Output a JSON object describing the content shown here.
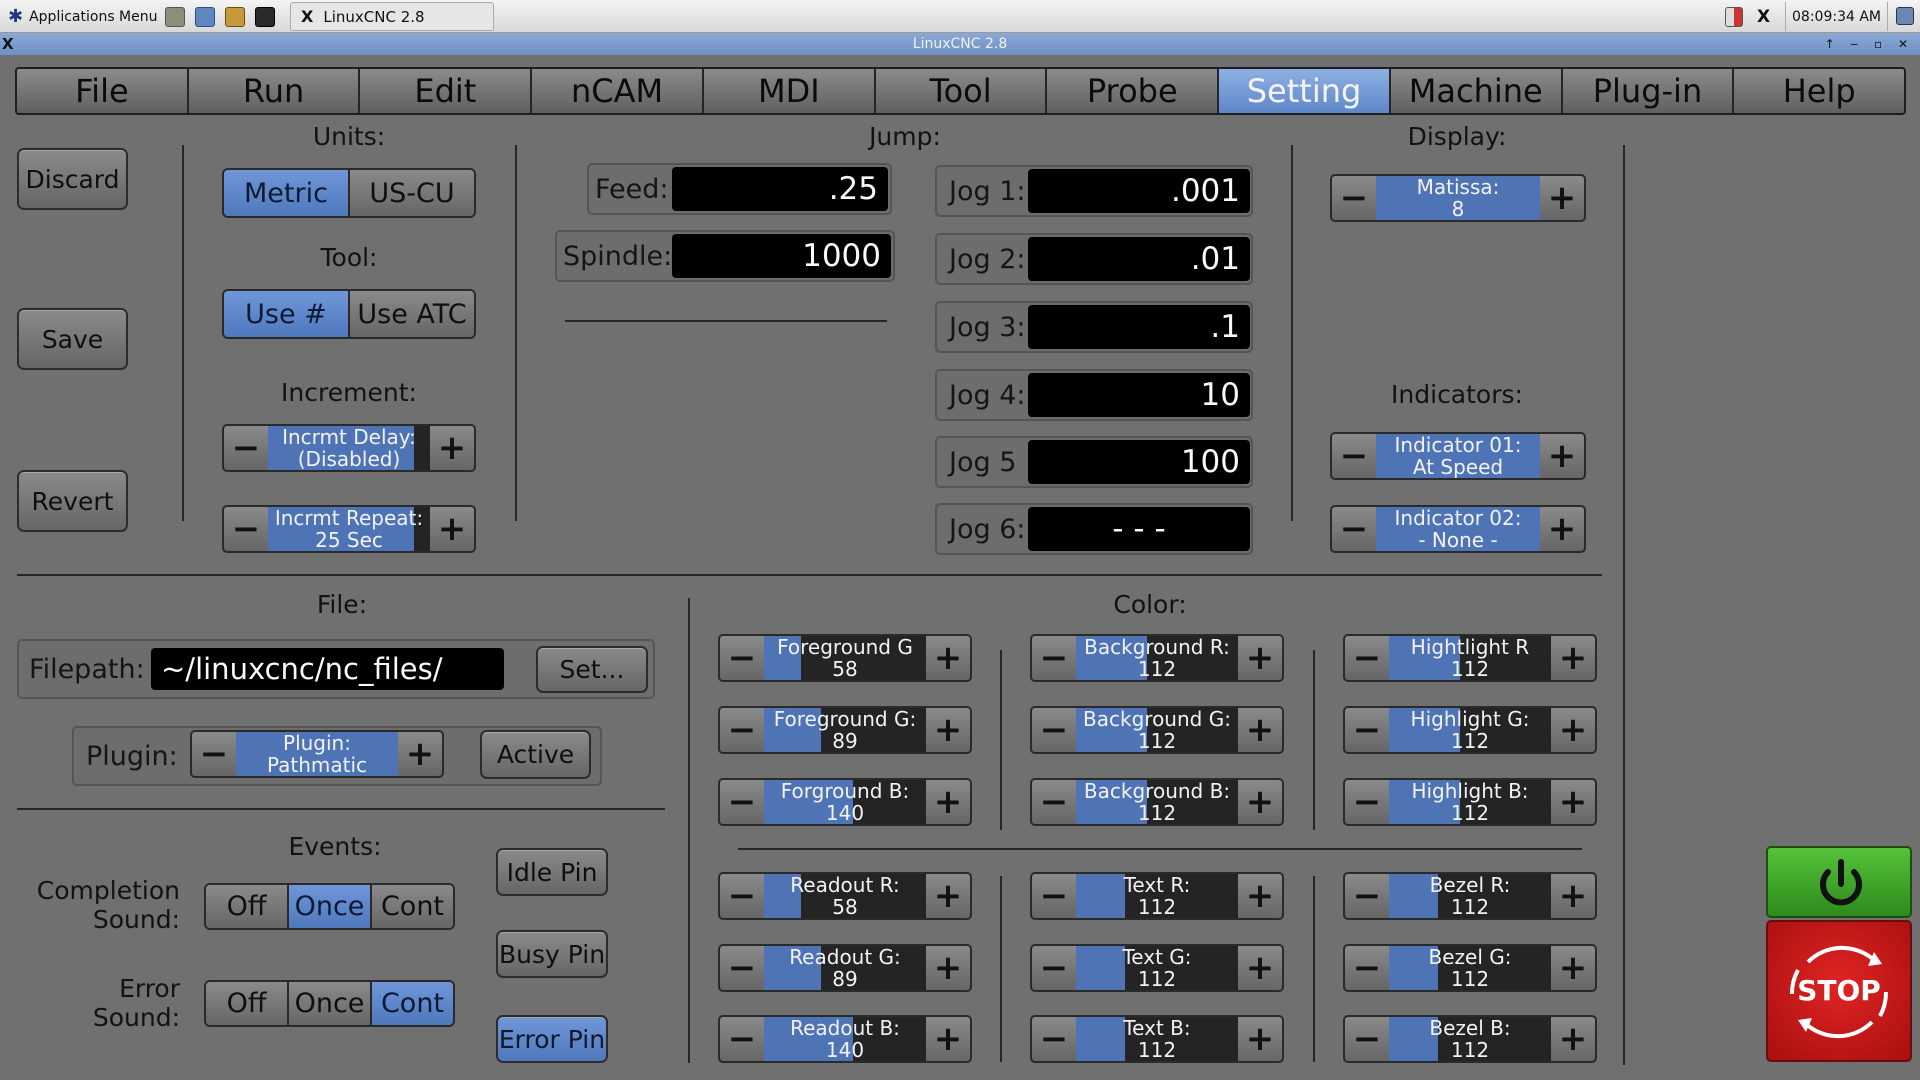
{
  "taskbar": {
    "apps_menu": "Applications Menu",
    "task_title": "LinuxCNC 2.8",
    "clock": "08:09:34 AM",
    "x_label": "X"
  },
  "window": {
    "title": "LinuxCNC 2.8"
  },
  "menu": {
    "tabs": [
      "File",
      "Run",
      "Edit",
      "nCAM",
      "MDI",
      "Tool",
      "Probe",
      "Setting",
      "Machine",
      "Plug-in",
      "Help"
    ],
    "active": "Setting"
  },
  "actions": {
    "discard": "Discard",
    "save": "Save",
    "revert": "Revert"
  },
  "units": {
    "heading": "Units:",
    "options": [
      "Metric",
      "US-CU"
    ],
    "selected": "Metric"
  },
  "tool": {
    "heading": "Tool:",
    "options": [
      "Use #",
      "Use ATC"
    ],
    "selected": "Use #"
  },
  "increment": {
    "heading": "Increment:",
    "delay": {
      "line1": "Incrmt Delay:",
      "line2": "(Disabled)",
      "fill": 0.9
    },
    "repeat": {
      "line1": "Incrmt Repeat:",
      "line2": "25 Sec",
      "fill": 0.9
    }
  },
  "jump": {
    "heading": "Jump:",
    "feed_label": "Feed:",
    "feed_value": ".25",
    "spindle_label": "Spindle:",
    "spindle_value": "1000",
    "jogs": [
      {
        "label": "Jog 1:",
        "value": ".001"
      },
      {
        "label": "Jog 2:",
        "value": ".01"
      },
      {
        "label": "Jog 3:",
        "value": ".1"
      },
      {
        "label": "Jog 4:",
        "value": "10"
      },
      {
        "label": "Jog 5",
        "value": "100"
      },
      {
        "label": "Jog 6:",
        "value": "- - -"
      }
    ]
  },
  "display": {
    "heading": "Display:",
    "theme": {
      "line1": "Matissa:",
      "line2": "8",
      "fill": 1.0
    }
  },
  "indicators": {
    "heading": "Indicators:",
    "items": [
      {
        "line1": "Indicator 01:",
        "line2": "At Speed",
        "fill": 1.0
      },
      {
        "line1": "Indicator 02:",
        "line2": "- None -",
        "fill": 1.0
      }
    ]
  },
  "file": {
    "heading": "File:",
    "filepath_label": "Filepath:",
    "filepath_value": "~/linuxcnc/nc_files/",
    "set_button": "Set...",
    "plugin_label": "Plugin:",
    "plugin": {
      "line1": "Plugin:",
      "line2": "Pathmatic",
      "fill": 1.0
    },
    "active_button": "Active"
  },
  "events": {
    "heading": "Events:",
    "completion_line1": "Completion",
    "completion_line2": "Sound:",
    "error_line1": "Error",
    "error_line2": "Sound:",
    "options": [
      "Off",
      "Once",
      "Cont"
    ],
    "completion_selected": "Once",
    "error_selected": "Cont",
    "idle_pin": "Idle Pin",
    "busy_pin": "Busy Pin",
    "error_pin": "Error Pin"
  },
  "color": {
    "heading": "Color:",
    "upper": [
      [
        {
          "name": "Foreground G",
          "value": "58",
          "fill": 0.23
        },
        {
          "name": "Foreground  G:",
          "value": "89",
          "fill": 0.35
        },
        {
          "name": "Forground B:",
          "value": "140",
          "fill": 0.55
        }
      ],
      [
        {
          "name": "Background R:",
          "value": "112",
          "fill": 0.44
        },
        {
          "name": "Background G:",
          "value": "112",
          "fill": 0.44
        },
        {
          "name": "Background B:",
          "value": "112",
          "fill": 0.44
        }
      ],
      [
        {
          "name": "Hightlight R",
          "value": "112",
          "fill": 0.44
        },
        {
          "name": "Highlight G:",
          "value": "112",
          "fill": 0.44
        },
        {
          "name": "Highlight B:",
          "value": "112",
          "fill": 0.44
        }
      ]
    ],
    "lower": [
      [
        {
          "name": "Readout R:",
          "value": "58",
          "fill": 0.23
        },
        {
          "name": "Readout G:",
          "value": "89",
          "fill": 0.35
        },
        {
          "name": "Readout B:",
          "value": "140",
          "fill": 0.55
        }
      ],
      [
        {
          "name": "Text R:",
          "value": "112",
          "fill": 0.3
        },
        {
          "name": "Text G:",
          "value": "112",
          "fill": 0.3
        },
        {
          "name": "Text B:",
          "value": "112",
          "fill": 0.3
        }
      ],
      [
        {
          "name": "Bezel R:",
          "value": "112",
          "fill": 0.3
        },
        {
          "name": "Bezel G:",
          "value": "112",
          "fill": 0.3
        },
        {
          "name": "Bezel B:",
          "value": "112",
          "fill": 0.3
        }
      ]
    ]
  },
  "estop": {
    "label": "STOP"
  },
  "colors": {
    "accent": "#5e86c8",
    "panel": "#707070",
    "power": "#3aa524",
    "stop": "#c91818"
  }
}
